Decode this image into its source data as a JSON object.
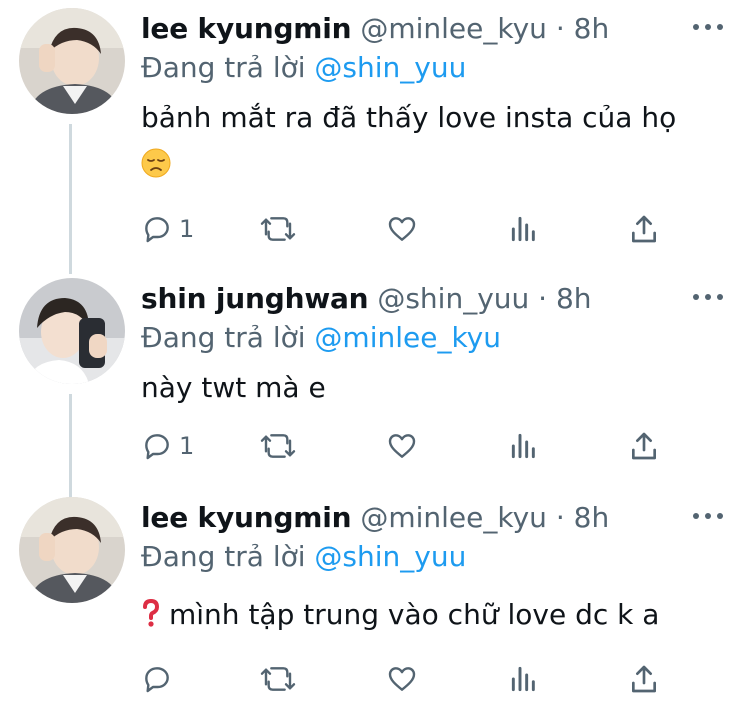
{
  "colors": {
    "text": "#0f1419",
    "secondary": "#536471",
    "link": "#1d9bf0",
    "line": "#cfd9de"
  },
  "tweets": [
    {
      "name": "lee kyungmin",
      "handle": "@minlee_kyu",
      "dot": "·",
      "time": "8h",
      "reply_prefix": "Đang trả lời",
      "reply_to": "@shin_yuu",
      "text": "bảnh mắt ra đã thấy love insta của họ",
      "emoji": "disappointed-face-icon",
      "reply_count": "1"
    },
    {
      "name": "shin junghwan",
      "handle": "@shin_yuu",
      "dot": "·",
      "time": "8h",
      "reply_prefix": "Đang trả lời",
      "reply_to": "@minlee_kyu",
      "text": "này twt mà e",
      "reply_count": "1"
    },
    {
      "name": "lee kyungmin",
      "handle": "@minlee_kyu",
      "dot": "·",
      "time": "8h",
      "reply_prefix": "Đang trả lời",
      "reply_to": "@shin_yuu",
      "text_emoji": "red-question-mark-icon",
      "text": "mình tập trung vào chữ love dc k a",
      "reply_count": ""
    }
  ]
}
